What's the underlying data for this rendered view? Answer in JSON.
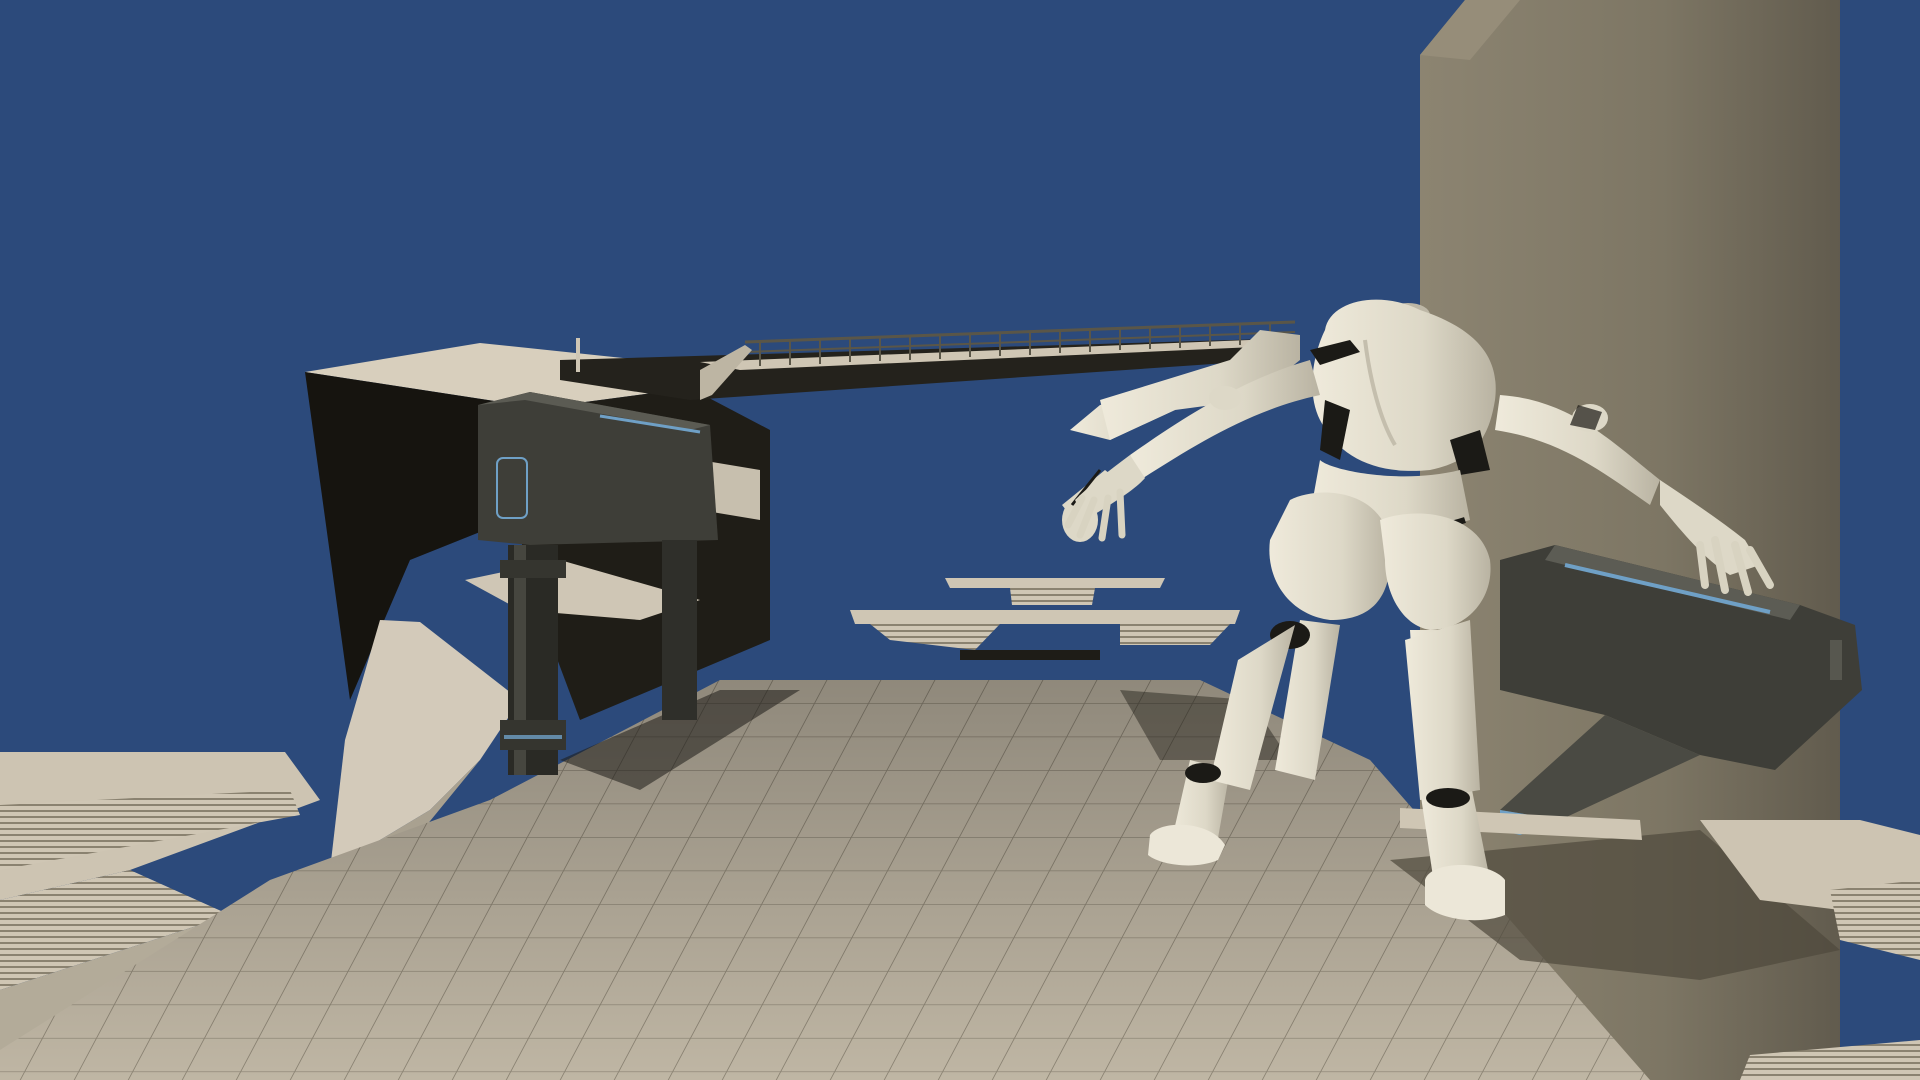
{
  "scene": {
    "sky_color": "#2c4a7b",
    "floor_color": "#bfb6a4",
    "floor_grout_color": "#8c8474",
    "tower_light_color": "#8c8471",
    "tower_dark_color": "#5e584b",
    "block_light_color": "#d8cfbd",
    "block_shadow_color": "#16140f",
    "character_color": "#ddd8c7",
    "character_joint_color": "#1b1a16",
    "machine_color": "#3e3e38",
    "machine_accent_color": "#6fa0c6"
  },
  "objects": {
    "sky": "sky-backdrop",
    "tower": "tall-pillar-right",
    "block_left": "stone-block-left",
    "ramp_left": "stair-ramp-left",
    "walkway": "railed-walkway-bridge",
    "floating_platforms": "floating-platforms-distant",
    "floor": "tiled-floor",
    "machine_left": "sci-fi-pillar-machine-left",
    "machine_right": "sci-fi-cannon-right",
    "character": "humanoid-mannequin-character",
    "stairs_right": "stairs-right-edge"
  }
}
